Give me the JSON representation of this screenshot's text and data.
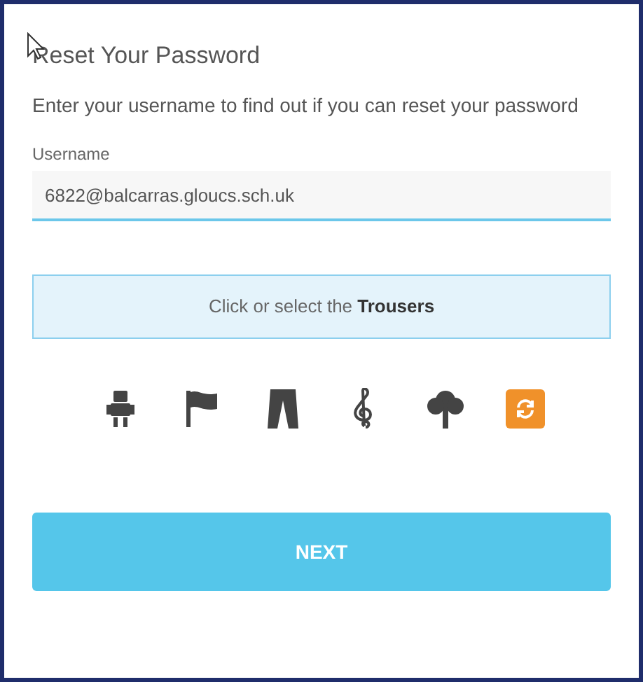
{
  "title": "Reset Your Password",
  "instructions": "Enter your username to find out if you can reset your password",
  "username": {
    "label": "Username",
    "value": "6822@balcarras.gloucs.sch.uk"
  },
  "captcha": {
    "prompt": "Click or select the **Trousers**",
    "options": [
      {
        "kind": "robot",
        "selected": false
      },
      {
        "kind": "flag",
        "selected": false
      },
      {
        "kind": "trousers",
        "selected": false
      },
      {
        "kind": "clef",
        "selected": false
      },
      {
        "kind": "tree",
        "selected": false
      }
    ]
  },
  "next_button": "NEXT"
}
